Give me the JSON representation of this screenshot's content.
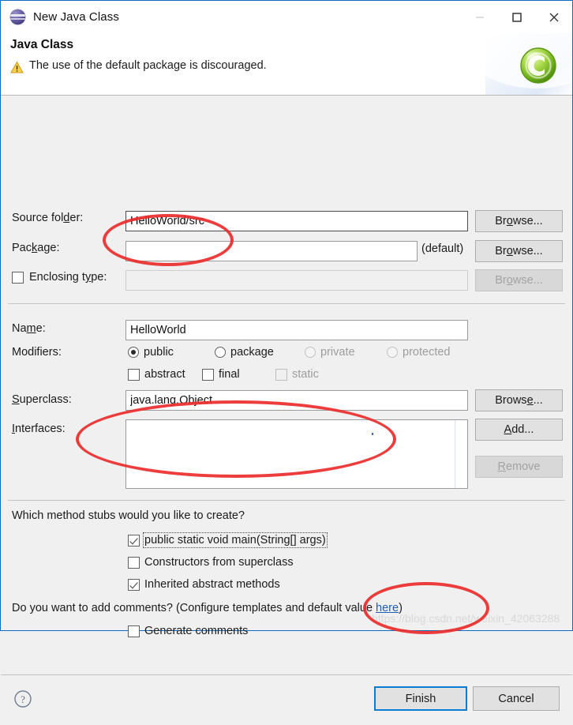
{
  "window": {
    "title": "New Java Class",
    "icon": "eclipse-sphere-icon",
    "controls": {
      "minimize": "minimize-icon",
      "maximize": "maximize-icon",
      "close": "close-icon"
    }
  },
  "header": {
    "title": "Java Class",
    "message": "The use of the default package is discouraged.",
    "message_icon": "warning-icon",
    "badge_icon": "java-class-badge-icon"
  },
  "form": {
    "source_folder": {
      "label": "Source folder:",
      "value": "HelloWorld/src",
      "browse": "Browse..."
    },
    "package": {
      "label": "Package:",
      "value": "",
      "suffix": "(default)",
      "browse": "Browse..."
    },
    "enclosing_type": {
      "label": "Enclosing type:",
      "value": "",
      "checked": false,
      "browse": "Browse...",
      "disabled": true
    },
    "name": {
      "label": "Name:",
      "value": "HelloWorld"
    },
    "modifiers": {
      "label": "Modifiers:",
      "radios": [
        {
          "label": "public",
          "selected": true,
          "disabled": false
        },
        {
          "label": "package",
          "selected": false,
          "disabled": false
        },
        {
          "label": "private",
          "selected": false,
          "disabled": true
        },
        {
          "label": "protected",
          "selected": false,
          "disabled": true
        }
      ],
      "checkboxes": [
        {
          "label": "abstract",
          "checked": false,
          "disabled": false
        },
        {
          "label": "final",
          "checked": false,
          "disabled": false
        },
        {
          "label": "static",
          "checked": false,
          "disabled": true
        }
      ]
    },
    "superclass": {
      "label": "Superclass:",
      "value": "java.lang.Object",
      "browse": "Browse..."
    },
    "interfaces": {
      "label": "Interfaces:",
      "items": [],
      "add": "Add...",
      "remove": "Remove",
      "remove_disabled": true
    }
  },
  "stubs": {
    "question": "Which method stubs would you like to create?",
    "options": [
      {
        "label": "public static void main(String[] args)",
        "checked": true,
        "focused": true
      },
      {
        "label": "Constructors from superclass",
        "checked": false,
        "focused": false
      },
      {
        "label": "Inherited abstract methods",
        "checked": true,
        "focused": false
      }
    ]
  },
  "comments": {
    "question_prefix": "Do you want to add comments? (Configure templates and default value ",
    "link": "here",
    "question_suffix": ")",
    "option": {
      "label": "Generate comments",
      "checked": false
    }
  },
  "footer": {
    "help_icon": "help-question-icon",
    "finish": "Finish",
    "cancel": "Cancel"
  },
  "annotations": {
    "watermark": "https://blog.csdn.net/weixin_42063288",
    "highlight_color": "#ec2b2b",
    "ellipses": [
      {
        "name": "name-field-highlight"
      },
      {
        "name": "main-method-stub-highlight"
      },
      {
        "name": "finish-button-highlight"
      }
    ]
  }
}
